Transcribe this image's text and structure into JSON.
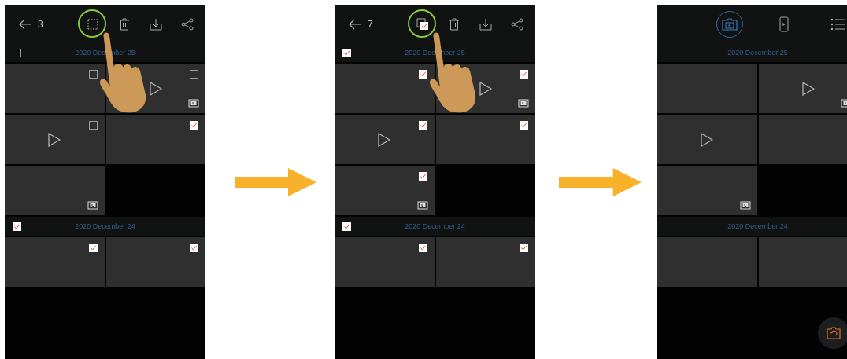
{
  "screens": [
    {
      "kind": "select",
      "count": "3",
      "all_selected": false,
      "highlighted": true,
      "hand": true,
      "groups": [
        {
          "date": "2020 December 25",
          "checked": false,
          "tiles": [
            {
              "kind": "photo",
              "checked": false
            },
            {
              "kind": "video",
              "checked": false,
              "badge": true
            },
            {
              "kind": "video",
              "checked": false
            },
            {
              "kind": "photo",
              "checked": true
            },
            {
              "kind": "photo",
              "badge": true
            }
          ]
        },
        {
          "date": "2020 December 24",
          "checked": true,
          "tiles": [
            {
              "kind": "photo",
              "checked": true
            },
            {
              "kind": "photo",
              "checked": true
            }
          ]
        }
      ]
    },
    {
      "kind": "select",
      "count": "7",
      "all_selected": true,
      "highlighted": true,
      "hand": true,
      "groups": [
        {
          "date": "2020 December 25",
          "checked": true,
          "tiles": [
            {
              "kind": "photo",
              "checked": true
            },
            {
              "kind": "video",
              "checked": true,
              "badge": true
            },
            {
              "kind": "video",
              "checked": true
            },
            {
              "kind": "photo",
              "checked": true
            },
            {
              "kind": "photo",
              "checked": true,
              "badge": true
            }
          ]
        },
        {
          "date": "2020 December 24",
          "checked": true,
          "tiles": [
            {
              "kind": "photo",
              "checked": true
            },
            {
              "kind": "photo",
              "checked": true
            }
          ]
        }
      ]
    },
    {
      "kind": "browse",
      "tabs": [
        {
          "kind": "camera",
          "selected": true
        },
        {
          "kind": "phone",
          "selected": false
        },
        {
          "kind": "list",
          "selected": false
        }
      ],
      "fab": true,
      "groups": [
        {
          "date": "2020 December 25",
          "tiles": [
            {
              "kind": "photo"
            },
            {
              "kind": "video",
              "badge": true
            },
            {
              "kind": "video"
            },
            {
              "kind": "photo"
            },
            {
              "kind": "photo",
              "badge": true
            }
          ]
        },
        {
          "date": "2020 December 24",
          "tiles": [
            {
              "kind": "photo"
            },
            {
              "kind": "photo"
            }
          ]
        }
      ]
    }
  ]
}
